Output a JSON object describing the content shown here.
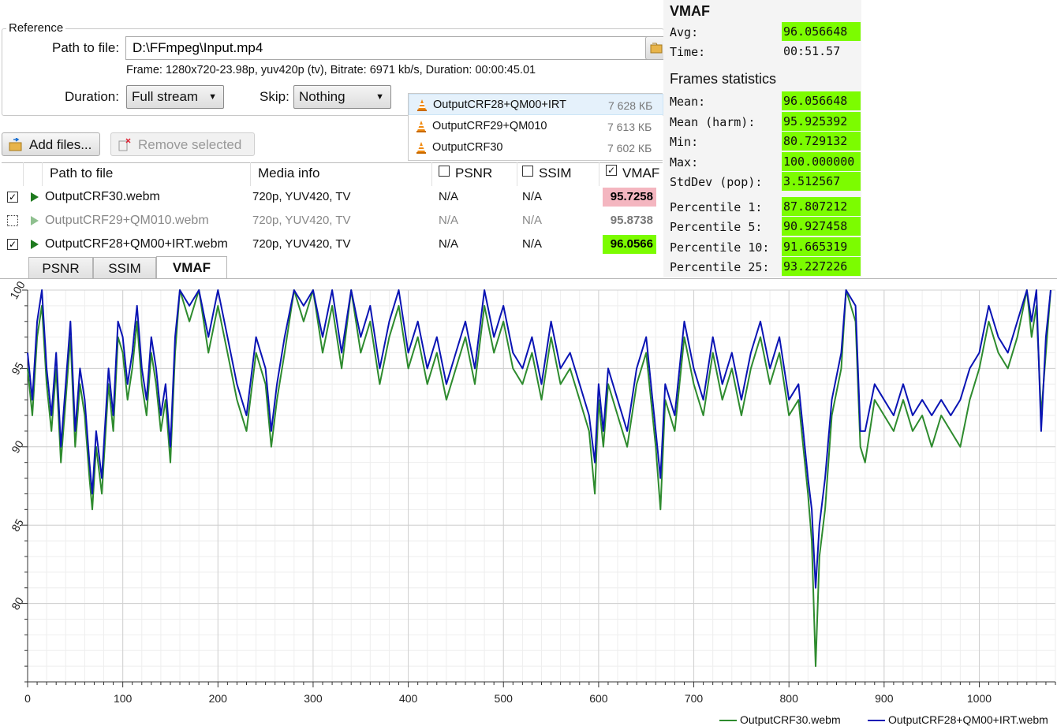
{
  "reference": {
    "group_label": "Reference",
    "path_label": "Path to file:",
    "path_value": "D:\\FFmpeg\\Input.mp4",
    "frame_info": "Frame: 1280x720-23.98p, yuv420p (tv), Bitrate: 6971 kb/s, Duration: 00:00:45.01",
    "duration_label": "Duration:",
    "duration_value": "Full stream",
    "skip_label": "Skip:",
    "skip_value": "Nothing"
  },
  "dropdown": {
    "items": [
      {
        "name": "OutputCRF28+QM00+IRT",
        "size": "7 628 КБ"
      },
      {
        "name": "OutputCRF29+QM010",
        "size": "7 613 КБ"
      },
      {
        "name": "OutputCRF30",
        "size": "7 602 КБ"
      }
    ]
  },
  "toolbar": {
    "add_label": "Add files...",
    "remove_label": "Remove selected"
  },
  "table": {
    "headers": {
      "path": "Path to file",
      "media": "Media info",
      "psnr": "PSNR",
      "ssim": "SSIM",
      "vmaf": "VMAF"
    },
    "rows": [
      {
        "file": "OutputCRF30.webm",
        "media": "720p, YUV420, TV",
        "psnr": "N/A",
        "ssim": "N/A",
        "vmaf": "95.7258",
        "checked": "✓"
      },
      {
        "file": "OutputCRF29+QM010.webm",
        "media": "720p, YUV420, TV",
        "psnr": "N/A",
        "ssim": "N/A",
        "vmaf": "95.8738",
        "checked": ""
      },
      {
        "file": "OutputCRF28+QM00+IRT.webm",
        "media": "720p, YUV420, TV",
        "psnr": "N/A",
        "ssim": "N/A",
        "vmaf": "96.0566",
        "checked": "✓"
      }
    ]
  },
  "tabs": [
    "PSNR",
    "SSIM",
    "VMAF"
  ],
  "stats": {
    "title": "VMAF",
    "avg_label": "Avg:",
    "avg": "96.056648",
    "time_label": "Time:",
    "time": "00:51.57",
    "frames_title": "Frames statistics",
    "rows": [
      {
        "k": "Mean:",
        "v": "96.056648"
      },
      {
        "k": "Mean (harm):",
        "v": "95.925392"
      },
      {
        "k": "Min:",
        "v": "80.729132"
      },
      {
        "k": "Max:",
        "v": "100.000000"
      },
      {
        "k": "StdDev (pop):",
        "v": "3.512567"
      }
    ],
    "percentiles": [
      {
        "k": "Percentile 1:",
        "v": "87.807212"
      },
      {
        "k": "Percentile 5:",
        "v": "90.927458"
      },
      {
        "k": "Percentile 10:",
        "v": "91.665319"
      },
      {
        "k": "Percentile 25:",
        "v": "93.227226"
      }
    ]
  },
  "colors": {
    "green_series": "#2e8b2e",
    "blue_series": "#0a14b4",
    "highlight_green": "#7cfc00",
    "highlight_red": "#f4b6c0"
  },
  "chart_data": {
    "type": "line",
    "xlim": [
      0,
      1080
    ],
    "ylim": [
      75,
      100
    ],
    "x_ticks": [
      0,
      100,
      200,
      300,
      400,
      500,
      600,
      700,
      800,
      900,
      1000
    ],
    "y_ticks": [
      80,
      85,
      90,
      95,
      100
    ],
    "grid": true,
    "legend": "bottom-right",
    "series": [
      {
        "name": "OutputCRF30.webm",
        "color": "#2e8b2e",
        "points": [
          [
            0,
            95
          ],
          [
            5,
            92
          ],
          [
            10,
            97
          ],
          [
            15,
            99
          ],
          [
            20,
            94
          ],
          [
            25,
            91
          ],
          [
            30,
            95
          ],
          [
            35,
            89
          ],
          [
            40,
            93
          ],
          [
            45,
            97
          ],
          [
            50,
            90
          ],
          [
            55,
            94
          ],
          [
            60,
            92
          ],
          [
            65,
            88
          ],
          [
            68,
            86
          ],
          [
            72,
            90
          ],
          [
            78,
            87
          ],
          [
            85,
            94
          ],
          [
            90,
            91
          ],
          [
            95,
            97
          ],
          [
            100,
            96
          ],
          [
            105,
            93
          ],
          [
            110,
            95
          ],
          [
            115,
            98
          ],
          [
            120,
            94
          ],
          [
            125,
            92
          ],
          [
            130,
            96
          ],
          [
            135,
            94
          ],
          [
            140,
            91
          ],
          [
            145,
            93
          ],
          [
            150,
            89
          ],
          [
            155,
            96
          ],
          [
            160,
            100
          ],
          [
            170,
            98
          ],
          [
            180,
            100
          ],
          [
            190,
            96
          ],
          [
            200,
            99
          ],
          [
            210,
            96
          ],
          [
            220,
            93
          ],
          [
            230,
            91
          ],
          [
            240,
            96
          ],
          [
            250,
            94
          ],
          [
            256,
            90
          ],
          [
            262,
            93
          ],
          [
            270,
            96
          ],
          [
            280,
            100
          ],
          [
            290,
            98
          ],
          [
            300,
            100
          ],
          [
            310,
            96
          ],
          [
            320,
            99
          ],
          [
            330,
            95
          ],
          [
            340,
            100
          ],
          [
            350,
            96
          ],
          [
            360,
            98
          ],
          [
            370,
            94
          ],
          [
            380,
            97
          ],
          [
            390,
            99
          ],
          [
            400,
            95
          ],
          [
            410,
            97
          ],
          [
            420,
            94
          ],
          [
            430,
            96
          ],
          [
            440,
            93
          ],
          [
            450,
            95
          ],
          [
            460,
            97
          ],
          [
            470,
            94
          ],
          [
            480,
            99
          ],
          [
            490,
            96
          ],
          [
            500,
            98
          ],
          [
            510,
            95
          ],
          [
            520,
            94
          ],
          [
            530,
            96
          ],
          [
            540,
            93
          ],
          [
            550,
            97
          ],
          [
            560,
            94
          ],
          [
            570,
            95
          ],
          [
            580,
            93
          ],
          [
            590,
            91
          ],
          [
            596,
            87
          ],
          [
            600,
            93
          ],
          [
            605,
            90
          ],
          [
            610,
            94
          ],
          [
            620,
            92
          ],
          [
            630,
            90
          ],
          [
            640,
            94
          ],
          [
            650,
            96
          ],
          [
            660,
            90
          ],
          [
            665,
            86
          ],
          [
            670,
            93
          ],
          [
            680,
            91
          ],
          [
            690,
            97
          ],
          [
            700,
            94
          ],
          [
            710,
            92
          ],
          [
            720,
            96
          ],
          [
            730,
            93
          ],
          [
            740,
            95
          ],
          [
            750,
            92
          ],
          [
            760,
            95
          ],
          [
            770,
            97
          ],
          [
            780,
            94
          ],
          [
            790,
            96
          ],
          [
            800,
            92
          ],
          [
            810,
            93
          ],
          [
            815,
            90
          ],
          [
            820,
            87
          ],
          [
            824,
            84
          ],
          [
            828,
            76
          ],
          [
            832,
            83
          ],
          [
            838,
            86
          ],
          [
            845,
            92
          ],
          [
            855,
            95
          ],
          [
            860,
            100
          ],
          [
            870,
            98
          ],
          [
            875,
            90
          ],
          [
            880,
            89
          ],
          [
            890,
            93
          ],
          [
            900,
            92
          ],
          [
            910,
            91
          ],
          [
            920,
            93
          ],
          [
            930,
            91
          ],
          [
            940,
            92
          ],
          [
            950,
            90
          ],
          [
            960,
            92
          ],
          [
            970,
            91
          ],
          [
            980,
            90
          ],
          [
            990,
            93
          ],
          [
            1000,
            95
          ],
          [
            1010,
            98
          ],
          [
            1020,
            96
          ],
          [
            1030,
            95
          ],
          [
            1040,
            97
          ],
          [
            1050,
            100
          ],
          [
            1055,
            97
          ],
          [
            1060,
            99
          ],
          [
            1065,
            92
          ],
          [
            1070,
            96
          ],
          [
            1075,
            100
          ]
        ]
      },
      {
        "name": "OutputCRF28+QM00+IRT.webm",
        "color": "#0a14b4",
        "points": [
          [
            0,
            96
          ],
          [
            5,
            93
          ],
          [
            10,
            98
          ],
          [
            15,
            100
          ],
          [
            20,
            95
          ],
          [
            25,
            92
          ],
          [
            30,
            96
          ],
          [
            35,
            90
          ],
          [
            40,
            94
          ],
          [
            45,
            98
          ],
          [
            50,
            91
          ],
          [
            55,
            95
          ],
          [
            60,
            93
          ],
          [
            65,
            89
          ],
          [
            68,
            87
          ],
          [
            72,
            91
          ],
          [
            78,
            88
          ],
          [
            85,
            95
          ],
          [
            90,
            92
          ],
          [
            95,
            98
          ],
          [
            100,
            97
          ],
          [
            105,
            94
          ],
          [
            110,
            96
          ],
          [
            115,
            99
          ],
          [
            120,
            95
          ],
          [
            125,
            93
          ],
          [
            130,
            97
          ],
          [
            135,
            95
          ],
          [
            140,
            92
          ],
          [
            145,
            94
          ],
          [
            150,
            90
          ],
          [
            155,
            97
          ],
          [
            160,
            100
          ],
          [
            170,
            99
          ],
          [
            180,
            100
          ],
          [
            190,
            97
          ],
          [
            200,
            100
          ],
          [
            210,
            97
          ],
          [
            220,
            94
          ],
          [
            230,
            92
          ],
          [
            240,
            97
          ],
          [
            250,
            95
          ],
          [
            256,
            91
          ],
          [
            262,
            94
          ],
          [
            270,
            97
          ],
          [
            280,
            100
          ],
          [
            290,
            99
          ],
          [
            300,
            100
          ],
          [
            310,
            97
          ],
          [
            320,
            100
          ],
          [
            330,
            96
          ],
          [
            340,
            100
          ],
          [
            350,
            97
          ],
          [
            360,
            99
          ],
          [
            370,
            95
          ],
          [
            380,
            98
          ],
          [
            390,
            100
          ],
          [
            400,
            96
          ],
          [
            410,
            98
          ],
          [
            420,
            95
          ],
          [
            430,
            97
          ],
          [
            440,
            94
          ],
          [
            450,
            96
          ],
          [
            460,
            98
          ],
          [
            470,
            95
          ],
          [
            480,
            100
          ],
          [
            490,
            97
          ],
          [
            500,
            99
          ],
          [
            510,
            96
          ],
          [
            520,
            95
          ],
          [
            530,
            97
          ],
          [
            540,
            94
          ],
          [
            550,
            98
          ],
          [
            560,
            95
          ],
          [
            570,
            96
          ],
          [
            580,
            94
          ],
          [
            590,
            92
          ],
          [
            596,
            89
          ],
          [
            600,
            94
          ],
          [
            605,
            91
          ],
          [
            610,
            95
          ],
          [
            620,
            93
          ],
          [
            630,
            91
          ],
          [
            640,
            95
          ],
          [
            650,
            97
          ],
          [
            660,
            91
          ],
          [
            665,
            88
          ],
          [
            670,
            94
          ],
          [
            680,
            92
          ],
          [
            690,
            98
          ],
          [
            700,
            95
          ],
          [
            710,
            93
          ],
          [
            720,
            97
          ],
          [
            730,
            94
          ],
          [
            740,
            96
          ],
          [
            750,
            93
          ],
          [
            760,
            96
          ],
          [
            770,
            98
          ],
          [
            780,
            95
          ],
          [
            790,
            97
          ],
          [
            800,
            93
          ],
          [
            810,
            94
          ],
          [
            815,
            91
          ],
          [
            820,
            88
          ],
          [
            824,
            86
          ],
          [
            828,
            81
          ],
          [
            832,
            85
          ],
          [
            838,
            88
          ],
          [
            845,
            93
          ],
          [
            855,
            96
          ],
          [
            860,
            100
          ],
          [
            870,
            99
          ],
          [
            875,
            91
          ],
          [
            880,
            91
          ],
          [
            890,
            94
          ],
          [
            900,
            93
          ],
          [
            910,
            92
          ],
          [
            920,
            94
          ],
          [
            930,
            92
          ],
          [
            940,
            93
          ],
          [
            950,
            92
          ],
          [
            960,
            93
          ],
          [
            970,
            92
          ],
          [
            980,
            93
          ],
          [
            990,
            95
          ],
          [
            1000,
            96
          ],
          [
            1010,
            99
          ],
          [
            1020,
            97
          ],
          [
            1030,
            96
          ],
          [
            1040,
            98
          ],
          [
            1050,
            100
          ],
          [
            1055,
            98
          ],
          [
            1060,
            100
          ],
          [
            1065,
            91
          ],
          [
            1070,
            97
          ],
          [
            1075,
            100
          ]
        ]
      }
    ]
  }
}
